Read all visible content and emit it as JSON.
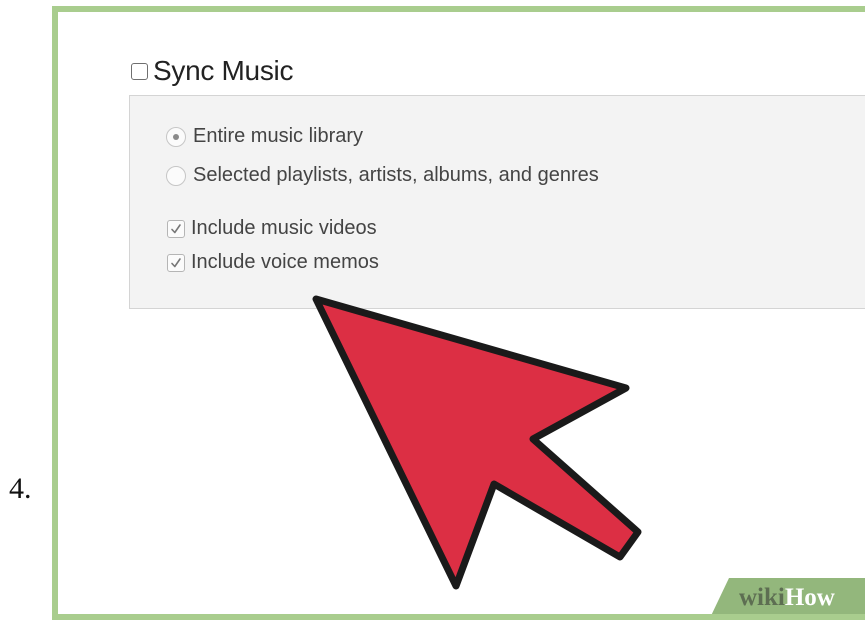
{
  "step": {
    "number": "4."
  },
  "sync_music": {
    "label": "Sync Music",
    "checked": false
  },
  "options": {
    "radio_entire_label": "Entire music library",
    "radio_entire_selected": true,
    "radio_selected_label": "Selected playlists, artists, albums, and genres",
    "radio_selected_selected": false,
    "include_videos_label": "Include music videos",
    "include_videos_checked": true,
    "include_memos_label": "Include voice memos",
    "include_memos_checked": true
  },
  "annotation": {
    "icon": "pointer-arrow-icon",
    "fill_color": "#dc2f44",
    "outline_color": "#1a1a1a"
  },
  "watermark": {
    "prefix": "wiki",
    "suffix": "How",
    "background_color": "#93b77c"
  },
  "colors": {
    "frame_border": "#a9cd8e",
    "panel_background": "#f3f3f3"
  }
}
